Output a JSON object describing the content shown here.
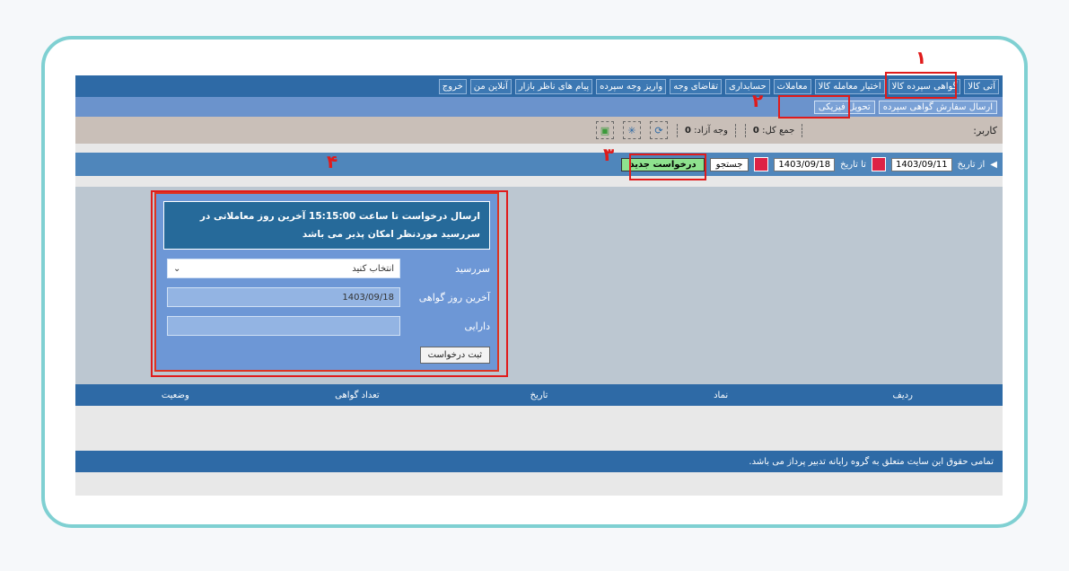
{
  "topnav": {
    "items": [
      "آتی کالا",
      "گواهی سپرده کالا",
      "اختیار معامله کالا",
      "معاملات",
      "حسابداری",
      "تقاضای وجه",
      "واریز وجه سپرده",
      "پیام های ناظر بازار",
      "آنلاین من",
      "خروج"
    ]
  },
  "subnav": {
    "items": [
      "ارسال سفارش گواهی سپرده",
      "تحویل فیزیکی"
    ]
  },
  "balance": {
    "user_label": "کاربر:",
    "total_label": "جمع کل:",
    "total_value": "0",
    "free_label": "وجه آزاد:",
    "free_value": "0"
  },
  "filter": {
    "from_label": "از تاریخ",
    "from_value": "1403/09/11",
    "to_label": "تا تاریخ",
    "to_value": "1403/09/18",
    "search_label": "جستجو",
    "new_request_label": "درخواست جدید"
  },
  "panel": {
    "notice": "ارسال درخواست تا ساعت 15:15:00 آخرین روز معاملاتی در سررسید موردنظر امکان پذیر می باشد",
    "due_label": "سررسید",
    "due_select": "انتخاب کنید",
    "lastday_label": "آخرین روز گواهی",
    "lastday_value": "1403/09/18",
    "asset_label": "دارایی",
    "submit_label": "ثبت درخواست"
  },
  "table": {
    "headers": [
      "ردیف",
      "نماد",
      "تاریخ",
      "تعداد گواهی",
      "وضعیت"
    ]
  },
  "footer": {
    "text": "تمامی حقوق این سایت متعلق به گروه رایانه تدبیر پرداز می باشد."
  },
  "annotations": {
    "n1": "۱",
    "n2": "۲",
    "n3": "۳",
    "n4": "۴"
  }
}
